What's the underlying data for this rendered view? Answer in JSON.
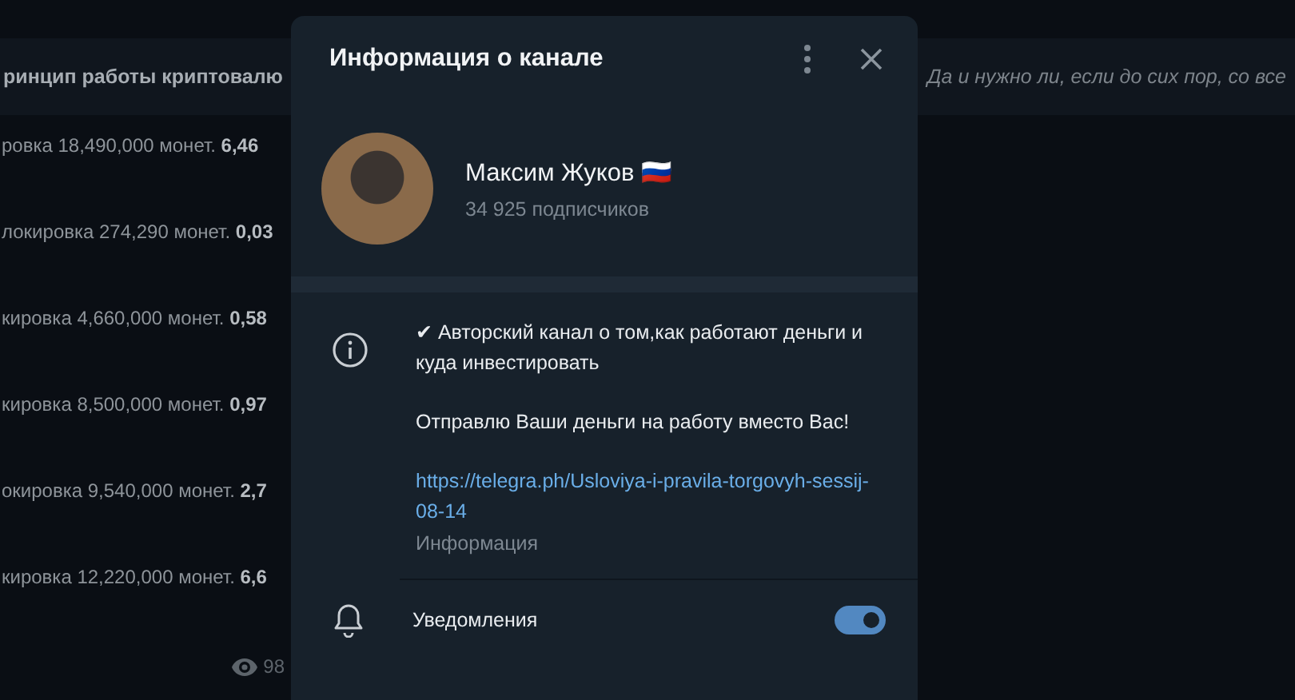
{
  "background_chat": {
    "pinned_left": "ринцип работы криптовалю",
    "pinned_right": "Да и нужно ли, если до сих пор, со все",
    "messages": [
      {
        "text": "ровка 18,490,000 монет. **6,46**"
      },
      {
        "text": "локировка 274,290 монет. **0,03**"
      },
      {
        "text": "кировка 4,660,000 монет. **0,58**"
      },
      {
        "text": "кировка 8,500,000 монет. **0,97**"
      },
      {
        "text": "окировка 9,540,000 монет. **2,7**"
      },
      {
        "text": "кировка 12,220,000 монет. **6,6**"
      }
    ],
    "views": "98"
  },
  "dialog": {
    "title": "Информация о канале",
    "channel": {
      "name": "Максим Жуков 🇷🇺",
      "subscribers": "34 925 подписчиков"
    },
    "description": {
      "paragraphs": [
        "✔ Авторский канал о том,как работают деньги и куда инвестировать",
        "Отправлю Ваши деньги на работу вместо Вас!"
      ],
      "link": "https://telegra.ph/Usloviya-i-pravila-torgovyh-sessij-08-14",
      "caption": "Информация"
    },
    "notifications": {
      "label": "Уведомления",
      "on": true
    }
  }
}
